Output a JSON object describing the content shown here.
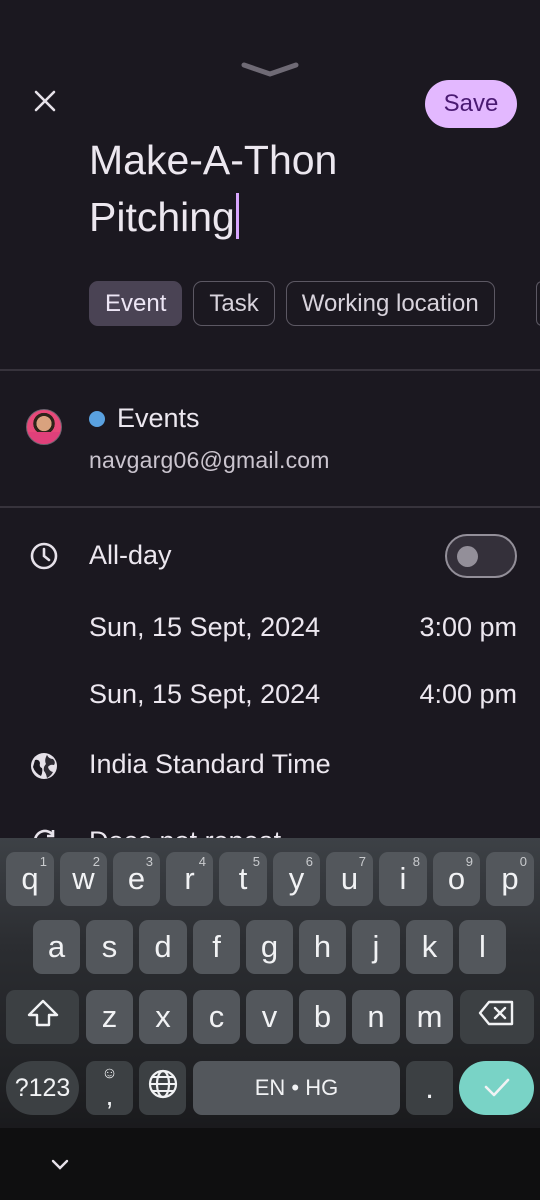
{
  "header": {
    "save_label": "Save"
  },
  "event": {
    "title_line1": "Make-A-Thon",
    "title_line2": "Pitching"
  },
  "type_chips": [
    {
      "label": "Event",
      "selected": true
    },
    {
      "label": "Task",
      "selected": false
    },
    {
      "label": "Working location",
      "selected": false
    }
  ],
  "calendar": {
    "name": "Events",
    "color": "#5aa1e0",
    "email": "navgarg06@gmail.com"
  },
  "all_day": {
    "label": "All-day",
    "enabled": false
  },
  "start": {
    "date": "Sun, 15 Sept, 2024",
    "time": "3:00 pm"
  },
  "end": {
    "date": "Sun, 15 Sept, 2024",
    "time": "4:00 pm"
  },
  "timezone": "India Standard Time",
  "repeat_label": "Does not repeat",
  "keyboard": {
    "row1": [
      {
        "key": "q",
        "hint": "1"
      },
      {
        "key": "w",
        "hint": "2"
      },
      {
        "key": "e",
        "hint": "3"
      },
      {
        "key": "r",
        "hint": "4"
      },
      {
        "key": "t",
        "hint": "5"
      },
      {
        "key": "y",
        "hint": "6"
      },
      {
        "key": "u",
        "hint": "7"
      },
      {
        "key": "i",
        "hint": "8"
      },
      {
        "key": "o",
        "hint": "9"
      },
      {
        "key": "p",
        "hint": "0"
      }
    ],
    "row2": [
      "a",
      "s",
      "d",
      "f",
      "g",
      "h",
      "j",
      "k",
      "l"
    ],
    "row3": [
      "z",
      "x",
      "c",
      "v",
      "b",
      "n",
      "m"
    ],
    "symbols_label": "?123",
    "comma_label": ",",
    "space_label": "EN • HG",
    "period_label": "."
  },
  "colors": {
    "background": "#1b1820",
    "save_button": "#e3b8ff",
    "cursor": "#d9a6ff",
    "keyboard_action": "#79d3c6"
  }
}
